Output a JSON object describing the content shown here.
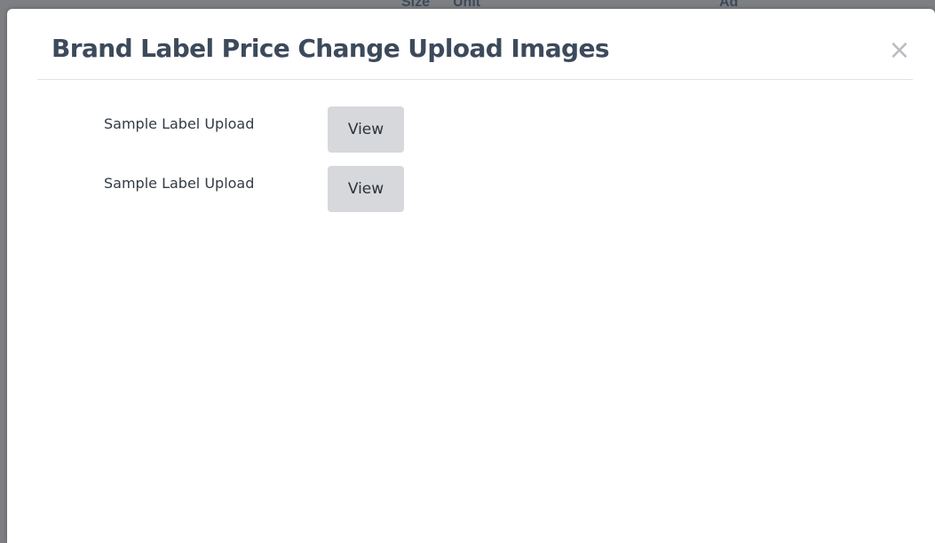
{
  "background": {
    "column_fragments": [
      "Size",
      "Unit",
      "Ad"
    ]
  },
  "modal": {
    "title": "Brand Label Price Change Upload Images",
    "close_symbol": "×",
    "rows": [
      {
        "label": "Sample Label Upload",
        "button_label": "View"
      },
      {
        "label": "Sample Label Upload",
        "button_label": "View"
      }
    ]
  },
  "colors": {
    "title": "#3d4a5c",
    "button_bg": "#d6d8db",
    "backdrop": "#7d7f82"
  }
}
